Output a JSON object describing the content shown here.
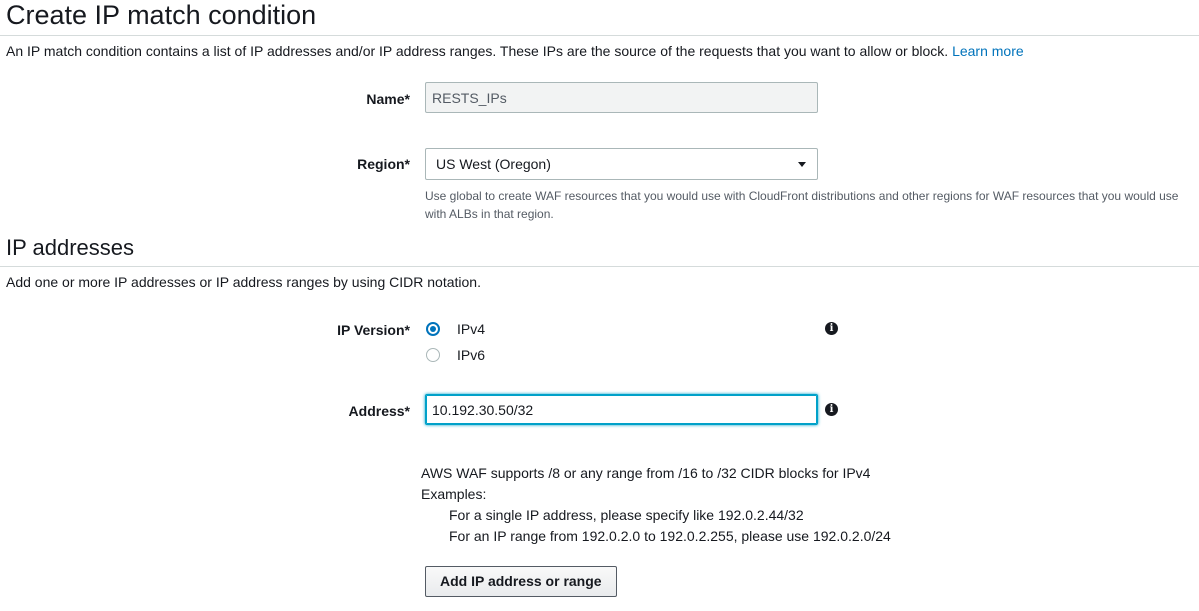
{
  "page": {
    "title": "Create IP match condition",
    "description": "An IP match condition contains a list of IP addresses and/or IP address ranges. These IPs are the source of the requests that you want to allow or block.",
    "learn_more": "Learn more"
  },
  "form": {
    "name_label": "Name*",
    "name_value": "RESTS_IPs",
    "region_label": "Region*",
    "region_value": "US West (Oregon)",
    "region_hint": "Use global to create WAF resources that you would use with CloudFront distributions and other regions for WAF resources that you would use with ALBs in that region."
  },
  "ip_section": {
    "title": "IP addresses",
    "description": "Add one or more IP addresses or IP address ranges by using CIDR notation.",
    "version_label": "IP Version*",
    "versions": [
      {
        "label": "IPv4",
        "selected": true
      },
      {
        "label": "IPv6",
        "selected": false
      }
    ],
    "address_label": "Address*",
    "address_value": "10.192.30.50/32",
    "help_line1": "AWS WAF supports /8 or any range from /16 to /32 CIDR blocks for IPv4",
    "help_line2": "Examples:",
    "help_example1": "For a single IP address, please specify like 192.0.2.44/32",
    "help_example2": "For an IP range from 192.0.2.0 to 192.0.2.255, please use 192.0.2.0/24",
    "add_button": "Add IP address or range"
  },
  "icons": {
    "info": "info-icon",
    "dropdown": "caret-down-icon"
  },
  "colors": {
    "link": "#0073bb",
    "focus": "#00a1c9"
  }
}
